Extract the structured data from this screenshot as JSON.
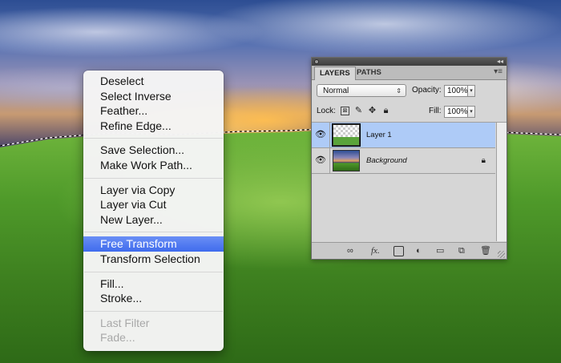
{
  "context_menu": {
    "groups": [
      [
        "Deselect",
        "Select Inverse",
        "Feather...",
        "Refine Edge..."
      ],
      [
        "Save Selection...",
        "Make Work Path..."
      ],
      [
        "Layer via Copy",
        "Layer via Cut",
        "New Layer..."
      ],
      [
        "Free Transform",
        "Transform Selection"
      ],
      [
        "Fill...",
        "Stroke..."
      ],
      [
        "Last Filter",
        "Fade..."
      ]
    ],
    "active_item": "Free Transform",
    "disabled_items": [
      "Last Filter",
      "Fade..."
    ],
    "highlight_color": "#3f6bed"
  },
  "layers_panel": {
    "tabs": [
      {
        "label": "LAYERS",
        "active": true
      },
      {
        "label": "PATHS",
        "active": false
      }
    ],
    "blend_mode": "Normal",
    "opacity_label": "Opacity:",
    "opacity_value": "100%",
    "lock_label": "Lock:",
    "fill_label": "Fill:",
    "fill_value": "100%",
    "layers": [
      {
        "name": "Layer 1",
        "selected": true,
        "visible": true,
        "locked": false
      },
      {
        "name": "Background",
        "selected": false,
        "visible": true,
        "locked": true
      }
    ],
    "selection_color": "#aecbf7",
    "footer_icons": [
      "link-icon",
      "fx-icon",
      "mask-icon",
      "adjustment-icon",
      "folder-icon",
      "new-layer-icon",
      "trash-icon"
    ],
    "fx_label": "fx."
  }
}
